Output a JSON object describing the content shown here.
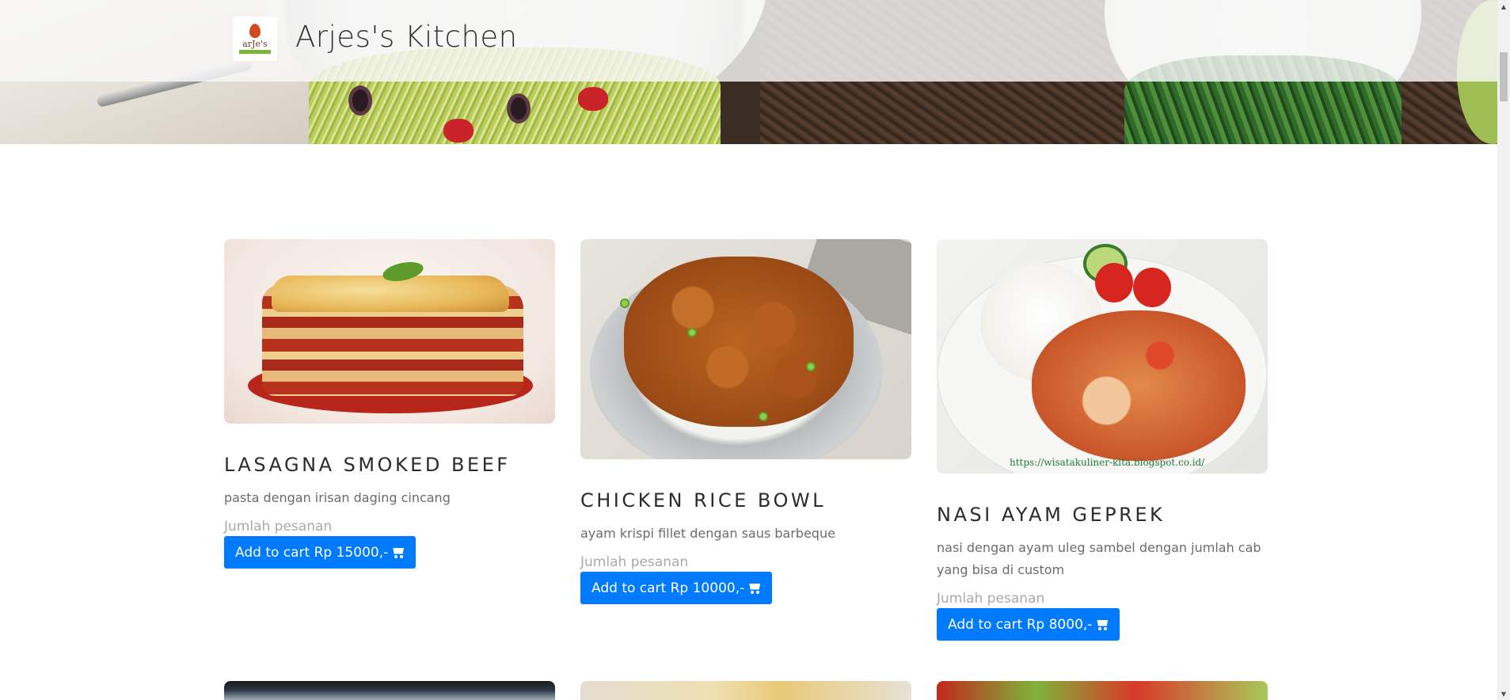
{
  "header": {
    "brand_title": "Arjes's Kitchen",
    "logo_text": "arJe's"
  },
  "products": [
    {
      "name": "LASAGNA SMOKED BEEF",
      "description": "pasta dengan irisan daging cincang",
      "qty_label": "Jumlah pesanan",
      "button_label": "Add to cart Rp 15000,-",
      "button_icon": "shopping-cart-icon"
    },
    {
      "name": "CHICKEN RICE BOWL",
      "description": "ayam krispi fillet dengan saus barbeque",
      "qty_label": "Jumlah pesanan",
      "button_label": "Add to cart Rp 10000,-",
      "button_icon": "shopping-cart-icon"
    },
    {
      "name": "NASI AYAM GEPREK",
      "description": "nasi dengan ayam uleg sambel dengan jumlah cab yang bisa di custom",
      "qty_label": "Jumlah pesanan",
      "button_label": "Add to cart Rp 8000,-",
      "button_icon": "shopping-cart-icon",
      "image_watermark": "https://wisatakuliner-kita.blogspot.co.id/"
    }
  ],
  "colors": {
    "button_bg": "#007bff",
    "button_text": "#ffffff",
    "title_text": "#2b2b2b",
    "desc_text": "#6b6b6b",
    "qty_text": "#a9a9a9"
  }
}
